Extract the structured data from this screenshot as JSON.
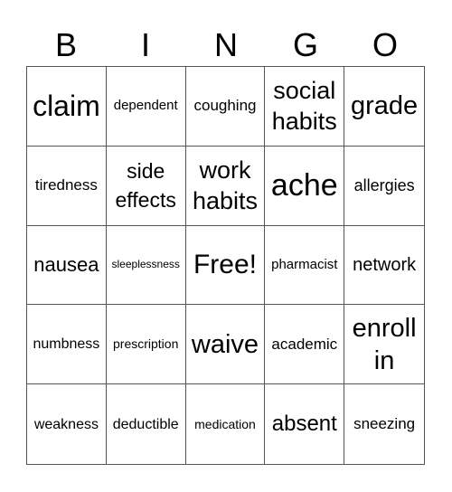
{
  "header": {
    "letters": [
      "B",
      "I",
      "N",
      "G",
      "O"
    ]
  },
  "cells": [
    {
      "text": "claim",
      "size": 32,
      "lh": 36
    },
    {
      "text": "dependent",
      "size": 15,
      "lh": 18
    },
    {
      "text": "coughing",
      "size": 17,
      "lh": 20
    },
    {
      "text": "social habits",
      "size": 27,
      "lh": 34
    },
    {
      "text": "grade",
      "size": 29,
      "lh": 34
    },
    {
      "text": "tiredness",
      "size": 17,
      "lh": 20
    },
    {
      "text": "side effects",
      "size": 23,
      "lh": 32
    },
    {
      "text": "work habits",
      "size": 27,
      "lh": 34
    },
    {
      "text": "ache",
      "size": 34,
      "lh": 38
    },
    {
      "text": "allergies",
      "size": 18,
      "lh": 22
    },
    {
      "text": "nausea",
      "size": 22,
      "lh": 26
    },
    {
      "text": "sleeplessness",
      "size": 12,
      "lh": 15
    },
    {
      "text": "Free!",
      "size": 30,
      "lh": 34
    },
    {
      "text": "pharmacist",
      "size": 15,
      "lh": 18
    },
    {
      "text": "network",
      "size": 20,
      "lh": 24
    },
    {
      "text": "numbness",
      "size": 16,
      "lh": 19
    },
    {
      "text": "prescription",
      "size": 14,
      "lh": 17
    },
    {
      "text": "waive",
      "size": 29,
      "lh": 34
    },
    {
      "text": "academic",
      "size": 17,
      "lh": 20
    },
    {
      "text": "enroll in",
      "size": 29,
      "lh": 36
    },
    {
      "text": "weakness",
      "size": 16,
      "lh": 19
    },
    {
      "text": "deductible",
      "size": 16,
      "lh": 19
    },
    {
      "text": "medication",
      "size": 14,
      "lh": 17
    },
    {
      "text": "absent",
      "size": 24,
      "lh": 28
    },
    {
      "text": "sneezing",
      "size": 17,
      "lh": 20
    }
  ]
}
